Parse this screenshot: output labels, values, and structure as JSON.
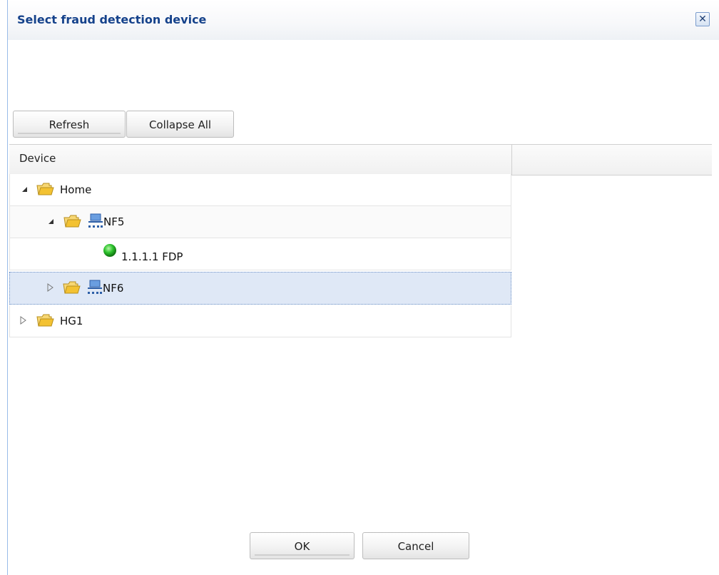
{
  "dialog": {
    "title": "Select fraud detection device",
    "close_label": "✕"
  },
  "toolbar": {
    "refresh_label": "Refresh",
    "collapse_label": "Collapse All"
  },
  "grid": {
    "column_header": "Device"
  },
  "tree": {
    "nodes": [
      {
        "label": "Home",
        "state": "expanded"
      },
      {
        "label": "NF5",
        "state": "expanded"
      },
      {
        "label": "1.1.1.1 FDP",
        "state": "leaf"
      },
      {
        "label": "NF6",
        "state": "collapsed",
        "selected": true
      },
      {
        "label": "HG1",
        "state": "collapsed"
      }
    ]
  },
  "footer": {
    "ok_label": "OK",
    "cancel_label": "Cancel"
  },
  "colors": {
    "title_text": "#15428b",
    "selected_row": "#dfe8f6",
    "status_online": "#2fc52f",
    "folder": "#f5c842"
  },
  "icons": {
    "close": "close-icon",
    "folder": "folder-icon",
    "network": "network-icon",
    "status": "status-online-icon",
    "expand": "triangle-expanded-icon",
    "collapse": "triangle-collapsed-icon"
  }
}
